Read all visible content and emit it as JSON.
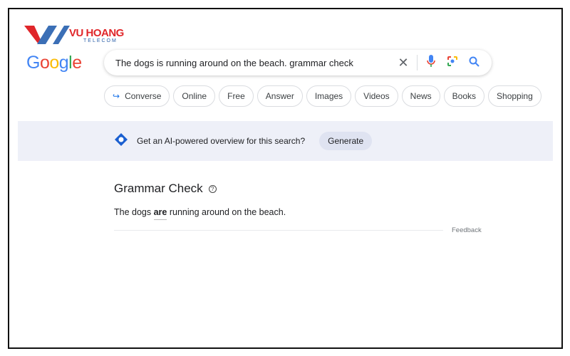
{
  "watermark": {
    "brand": "VU HOANG",
    "sub": "TELECOM"
  },
  "google_logo": {
    "letters": [
      "G",
      "o",
      "o",
      "g",
      "l",
      "e"
    ],
    "colors": [
      "#4285f4",
      "#ea4335",
      "#fbbc05",
      "#4285f4",
      "#34a853",
      "#ea4335"
    ]
  },
  "search": {
    "query": "The dogs is running around on the beach. grammar check",
    "icons": [
      "close-icon",
      "mic-icon",
      "lens-icon",
      "search-icon"
    ]
  },
  "chips": [
    "Converse",
    "Online",
    "Free",
    "Answer",
    "Images",
    "Videos",
    "News",
    "Books",
    "Shopping"
  ],
  "ai_overview": {
    "prompt": "Get an AI-powered overview for this search?",
    "button": "Generate"
  },
  "grammar": {
    "title": "Grammar Check",
    "before": "The dogs ",
    "correction": "are",
    "after": " running around on the beach.",
    "feedback": "Feedback"
  }
}
